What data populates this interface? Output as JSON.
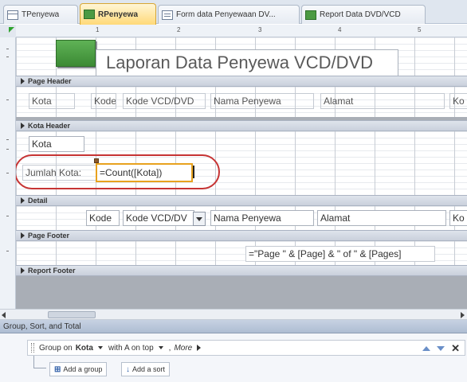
{
  "tabs": [
    {
      "label": "TPenyewa",
      "type": "table"
    },
    {
      "label": "RPenyewa",
      "type": "report",
      "active": true
    },
    {
      "label": "Form data Penyewaan DV...",
      "type": "form"
    },
    {
      "label": "Report Data DVD/VCD",
      "type": "report"
    }
  ],
  "ruler": {
    "numbers": [
      "1",
      "2",
      "3",
      "4",
      "5"
    ]
  },
  "report": {
    "title": "Laporan Data Penyewa VCD/DVD",
    "sections": {
      "page_header": "Page Header",
      "kota_header": "Kota Header",
      "detail": "Detail",
      "page_footer": "Page Footer",
      "report_footer": "Report Footer"
    },
    "page_header_labels": [
      "Kota",
      "Kode",
      "Kode VCD/DVD",
      "Nama Penyewa",
      "Alamat",
      "Ko"
    ],
    "kota_header": {
      "kota_field": "Kota",
      "jumlah_label": "Jumlah Kota:",
      "count_expr": "=Count([Kota])"
    },
    "detail_fields": [
      "Kode",
      "Kode VCD/DV",
      "Nama Penyewa",
      "Alamat",
      "Ko"
    ],
    "page_footer_expr": "=\"Page \" & [Page] & \" of \" & [Pages]"
  },
  "group_sort": {
    "title": "Group, Sort, and Total",
    "group_on_label": "Group on",
    "group_field": "Kota",
    "sort_order": "with A on top",
    "more": "More",
    "add_group": "Add a group",
    "add_sort": "Add a sort"
  },
  "colors": {
    "highlight_oval": "#c63333",
    "selection": "#e8a21e",
    "active_tab": "#ffd978"
  }
}
